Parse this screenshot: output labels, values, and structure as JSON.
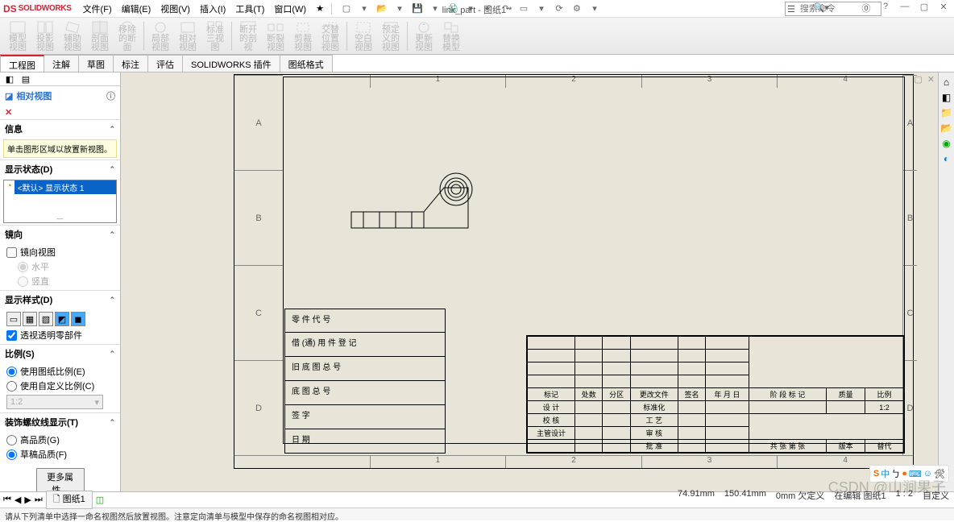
{
  "app": {
    "logo_s": "DS",
    "logo_name": "SOLIDWORKS"
  },
  "menu": {
    "file": "文件(F)",
    "edit": "编辑(E)",
    "view": "视图(V)",
    "insert": "插入(I)",
    "tools": "工具(T)",
    "window": "窗口(W)",
    "star": "★"
  },
  "title": "link_part - 图纸1 *",
  "search_placeholder": "搜索命令",
  "tabs": [
    "工程图",
    "注解",
    "草图",
    "标注",
    "评估",
    "SOLIDWORKS 插件",
    "图纸格式"
  ],
  "cmdmgr": [
    "模型视图",
    "投影视图",
    "辅助视图",
    "剖面视图",
    "移除的断面",
    "局部视图",
    "相对视图",
    "标准三视图",
    "断开的剖视",
    "断裂视图",
    "剪裁视图",
    "交替位置视图",
    "空白视图",
    "预定义的视图",
    "更新视图",
    "替换模型"
  ],
  "pm": {
    "title": "相对视图",
    "info_h": "信息",
    "info": "单击图形区域以放置新视图。",
    "display_state_h": "显示状态(D)",
    "state_sel": "<默认> 显示状态 1",
    "mirror_h": "镜向",
    "mirror_chk": "镜向视图",
    "mirror_r1": "水平",
    "mirror_r2": "竖直",
    "style_h": "显示样式(D)",
    "seethru": "透视透明零部件",
    "scale_h": "比例(S)",
    "scale_r1": "使用图纸比例(E)",
    "scale_r2": "使用自定义比例(C)",
    "scale_val": "1:2",
    "thread_h": "装饰螺纹线显示(T)",
    "thread_r1": "高品质(G)",
    "thread_r2": "草稿品质(F)",
    "more": "更多属性..."
  },
  "ruler_h": [
    "1",
    "2",
    "3",
    "4"
  ],
  "ruler_v": [
    "A",
    "B",
    "C",
    "D"
  ],
  "leftblock": [
    "零 件 代 号",
    "借 (通) 用 件 登 记",
    "旧 底 图 总 号",
    "底 图 总 号",
    "签   字",
    "日   期"
  ],
  "tblk": {
    "r1": [
      "标记",
      "处数",
      "分区",
      "更改文件",
      "签名",
      "年 月 日",
      "阶 段 标 记",
      "质量",
      "比例"
    ],
    "r2": [
      "设 计",
      "",
      "",
      "标准化",
      "",
      "",
      "",
      "",
      "1:2"
    ],
    "r3": [
      "校 核",
      "",
      "",
      "工 艺",
      "",
      "",
      "",
      "",
      ""
    ],
    "r4": [
      "主管设计",
      "",
      "",
      "审 核",
      "",
      "",
      "",
      "",
      ""
    ],
    "r5": [
      "",
      "",
      "",
      "批 准",
      "",
      "",
      "共  张 第  张",
      "版本",
      "替代"
    ]
  },
  "bottom": {
    "sheet": "图纸1"
  },
  "hint": "请从下列清单中选择一命名视图然后放置视图。注意定向清单与模型中保存的命名视图相对应。",
  "status": {
    "x": "74.91mm",
    "y": "150.41mm",
    "z": "0mm",
    "us": "欠定义",
    "edit": "在编辑 图纸1",
    "sc": "1 : 2",
    "cs": "自定义"
  },
  "watermark": "CSDN @山涧果子"
}
